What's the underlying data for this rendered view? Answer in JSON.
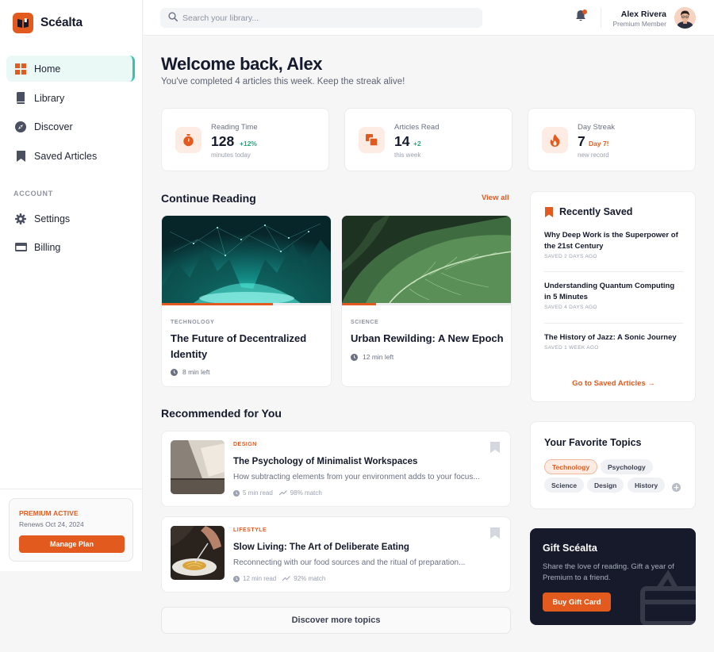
{
  "brand": {
    "name": "Scéalta"
  },
  "nav": {
    "items": [
      {
        "label": "Home",
        "icon": "grid-icon",
        "active": true
      },
      {
        "label": "Library",
        "icon": "book-icon"
      },
      {
        "label": "Discover",
        "icon": "compass-icon"
      },
      {
        "label": "Saved Articles",
        "icon": "bookmark-icon"
      }
    ],
    "section_label": "ACCOUNT",
    "account_items": [
      {
        "label": "Settings",
        "icon": "gear-icon"
      },
      {
        "label": "Billing",
        "icon": "credit-card-icon"
      }
    ]
  },
  "premium": {
    "title": "PREMIUM ACTIVE",
    "renews": "Renews Oct 24, 2024",
    "button": "Manage Plan"
  },
  "header": {
    "search_placeholder": "Search your library...",
    "user_name": "Alex Rivera",
    "user_role": "Premium Member"
  },
  "welcome": {
    "title": "Welcome back, Alex",
    "subtitle": "You've completed 4 articles this week. Keep the streak alive!"
  },
  "stats": [
    {
      "label": "Reading Time",
      "value": "128",
      "delta": "+12%",
      "note": "minutes today",
      "icon": "timer-icon",
      "delta_color": "#1fa67a"
    },
    {
      "label": "Articles Read",
      "value": "14",
      "delta": "+2",
      "note": "this week",
      "icon": "copy-icon",
      "delta_color": "#1fa67a"
    },
    {
      "label": "Day Streak",
      "value": "7",
      "delta": "Day 7!",
      "note": "new record",
      "icon": "flame-icon",
      "delta_color": "#e25a1e"
    }
  ],
  "continue_reading": {
    "title": "Continue Reading",
    "view_all": "View all",
    "cards": [
      {
        "category": "TECHNOLOGY",
        "title": "The Future of Decentralized Identity",
        "time_left": "8 min left",
        "progress": 0.65
      },
      {
        "category": "SCIENCE",
        "title": "Urban Rewilding: A New Epoch",
        "time_left": "12 min left",
        "progress": 0.2
      }
    ]
  },
  "recommended": {
    "title": "Recommended for You",
    "items": [
      {
        "category": "DESIGN",
        "title": "The Psychology of Minimalist Workspaces",
        "description": "How subtracting elements from your environment adds to your focus...",
        "read_time": "5 min read",
        "match": "98% match"
      },
      {
        "category": "LIFESTYLE",
        "title": "Slow Living: The Art of Deliberate Eating",
        "description": "Reconnecting with our food sources and the ritual of preparation...",
        "read_time": "12 min read",
        "match": "92% match"
      }
    ],
    "discover_button": "Discover more topics"
  },
  "recently_saved": {
    "title": "Recently Saved",
    "items": [
      {
        "title": "Why Deep Work is the Superpower of the 21st Century",
        "saved": "SAVED 2 DAYS AGO"
      },
      {
        "title": "Understanding Quantum Computing in 5 Minutes",
        "saved": "SAVED 4 DAYS AGO"
      },
      {
        "title": "The History of Jazz: A Sonic Journey",
        "saved": "SAVED 1 WEEK AGO"
      }
    ],
    "link": "Go to Saved Articles →"
  },
  "topics": {
    "title": "Your Favorite Topics",
    "chips": [
      "Technology",
      "Psychology",
      "Science",
      "Design",
      "History"
    ],
    "active": "Technology"
  },
  "gift": {
    "title": "Gift Scéalta",
    "text": "Share the love of reading. Gift a year of Premium to a friend.",
    "button": "Buy Gift Card"
  },
  "colors": {
    "accent": "#e25a1e",
    "teal": "#35c2b1",
    "positive": "#1fa67a",
    "dark_panel": "#161a2a"
  }
}
